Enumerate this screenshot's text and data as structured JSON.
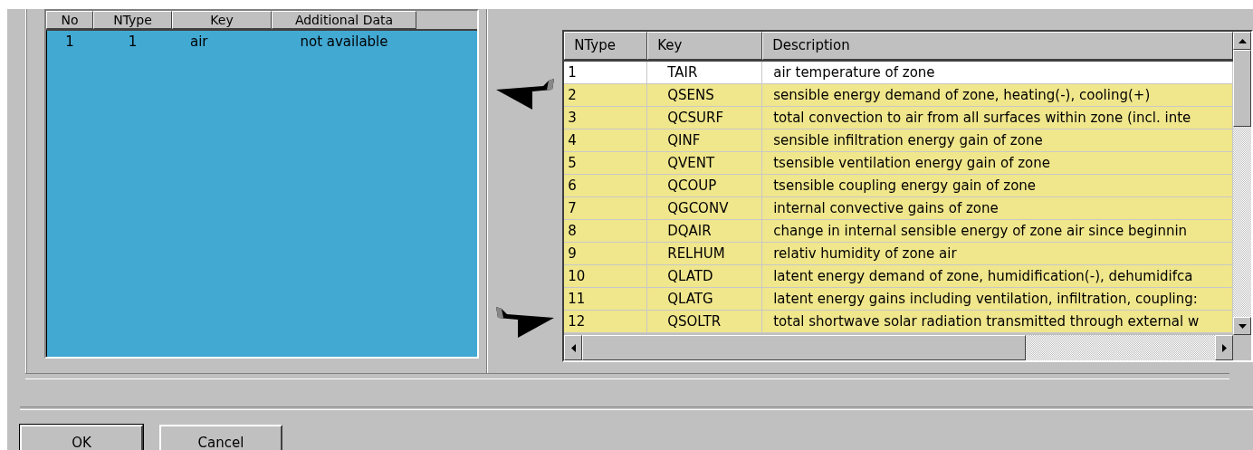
{
  "variables": {
    "columns": [
      "No",
      "NType",
      "Key",
      "Additional Data"
    ],
    "rows": [
      {
        "cells": [
          "1",
          "1",
          "air",
          "not available"
        ]
      }
    ]
  },
  "outputs": {
    "columns": [
      "NType",
      "Key",
      "Description"
    ],
    "rows": [
      {
        "cells": [
          "1",
          "TAIR",
          "air temperature of zone"
        ],
        "highlighted": false
      },
      {
        "cells": [
          "2",
          "QSENS",
          "sensible energy demand of zone, heating(-), cooling(+)"
        ],
        "highlighted": true
      },
      {
        "cells": [
          "3",
          "QCSURF",
          "total convection to air from all surfaces within zone (incl. inte"
        ],
        "highlighted": true
      },
      {
        "cells": [
          "4",
          "QINF",
          "sensible infiltration energy gain of zone"
        ],
        "highlighted": true
      },
      {
        "cells": [
          "5",
          "QVENT",
          "tsensible ventilation energy gain of zone"
        ],
        "highlighted": true
      },
      {
        "cells": [
          "6",
          "QCOUP",
          "tsensible coupling energy gain of zone"
        ],
        "highlighted": true
      },
      {
        "cells": [
          "7",
          "QGCONV",
          "internal convective gains of zone"
        ],
        "highlighted": true
      },
      {
        "cells": [
          "8",
          "DQAIR",
          "change in internal sensible energy of zone air since beginnin"
        ],
        "highlighted": true
      },
      {
        "cells": [
          "9",
          "RELHUM",
          "relativ humidity of zone air"
        ],
        "highlighted": true
      },
      {
        "cells": [
          "10",
          "QLATD",
          "latent energy demand of zone, humidification(-), dehumidifca"
        ],
        "highlighted": true
      },
      {
        "cells": [
          "11",
          "QLATG",
          "latent energy gains including ventilation, infiltration, coupling:"
        ],
        "highlighted": true
      },
      {
        "cells": [
          "12",
          "QSOLTR",
          "total shortwave solar radiation transmitted through external w"
        ],
        "highlighted": true
      }
    ]
  },
  "buttons": [
    "OK",
    "Cancel"
  ]
}
